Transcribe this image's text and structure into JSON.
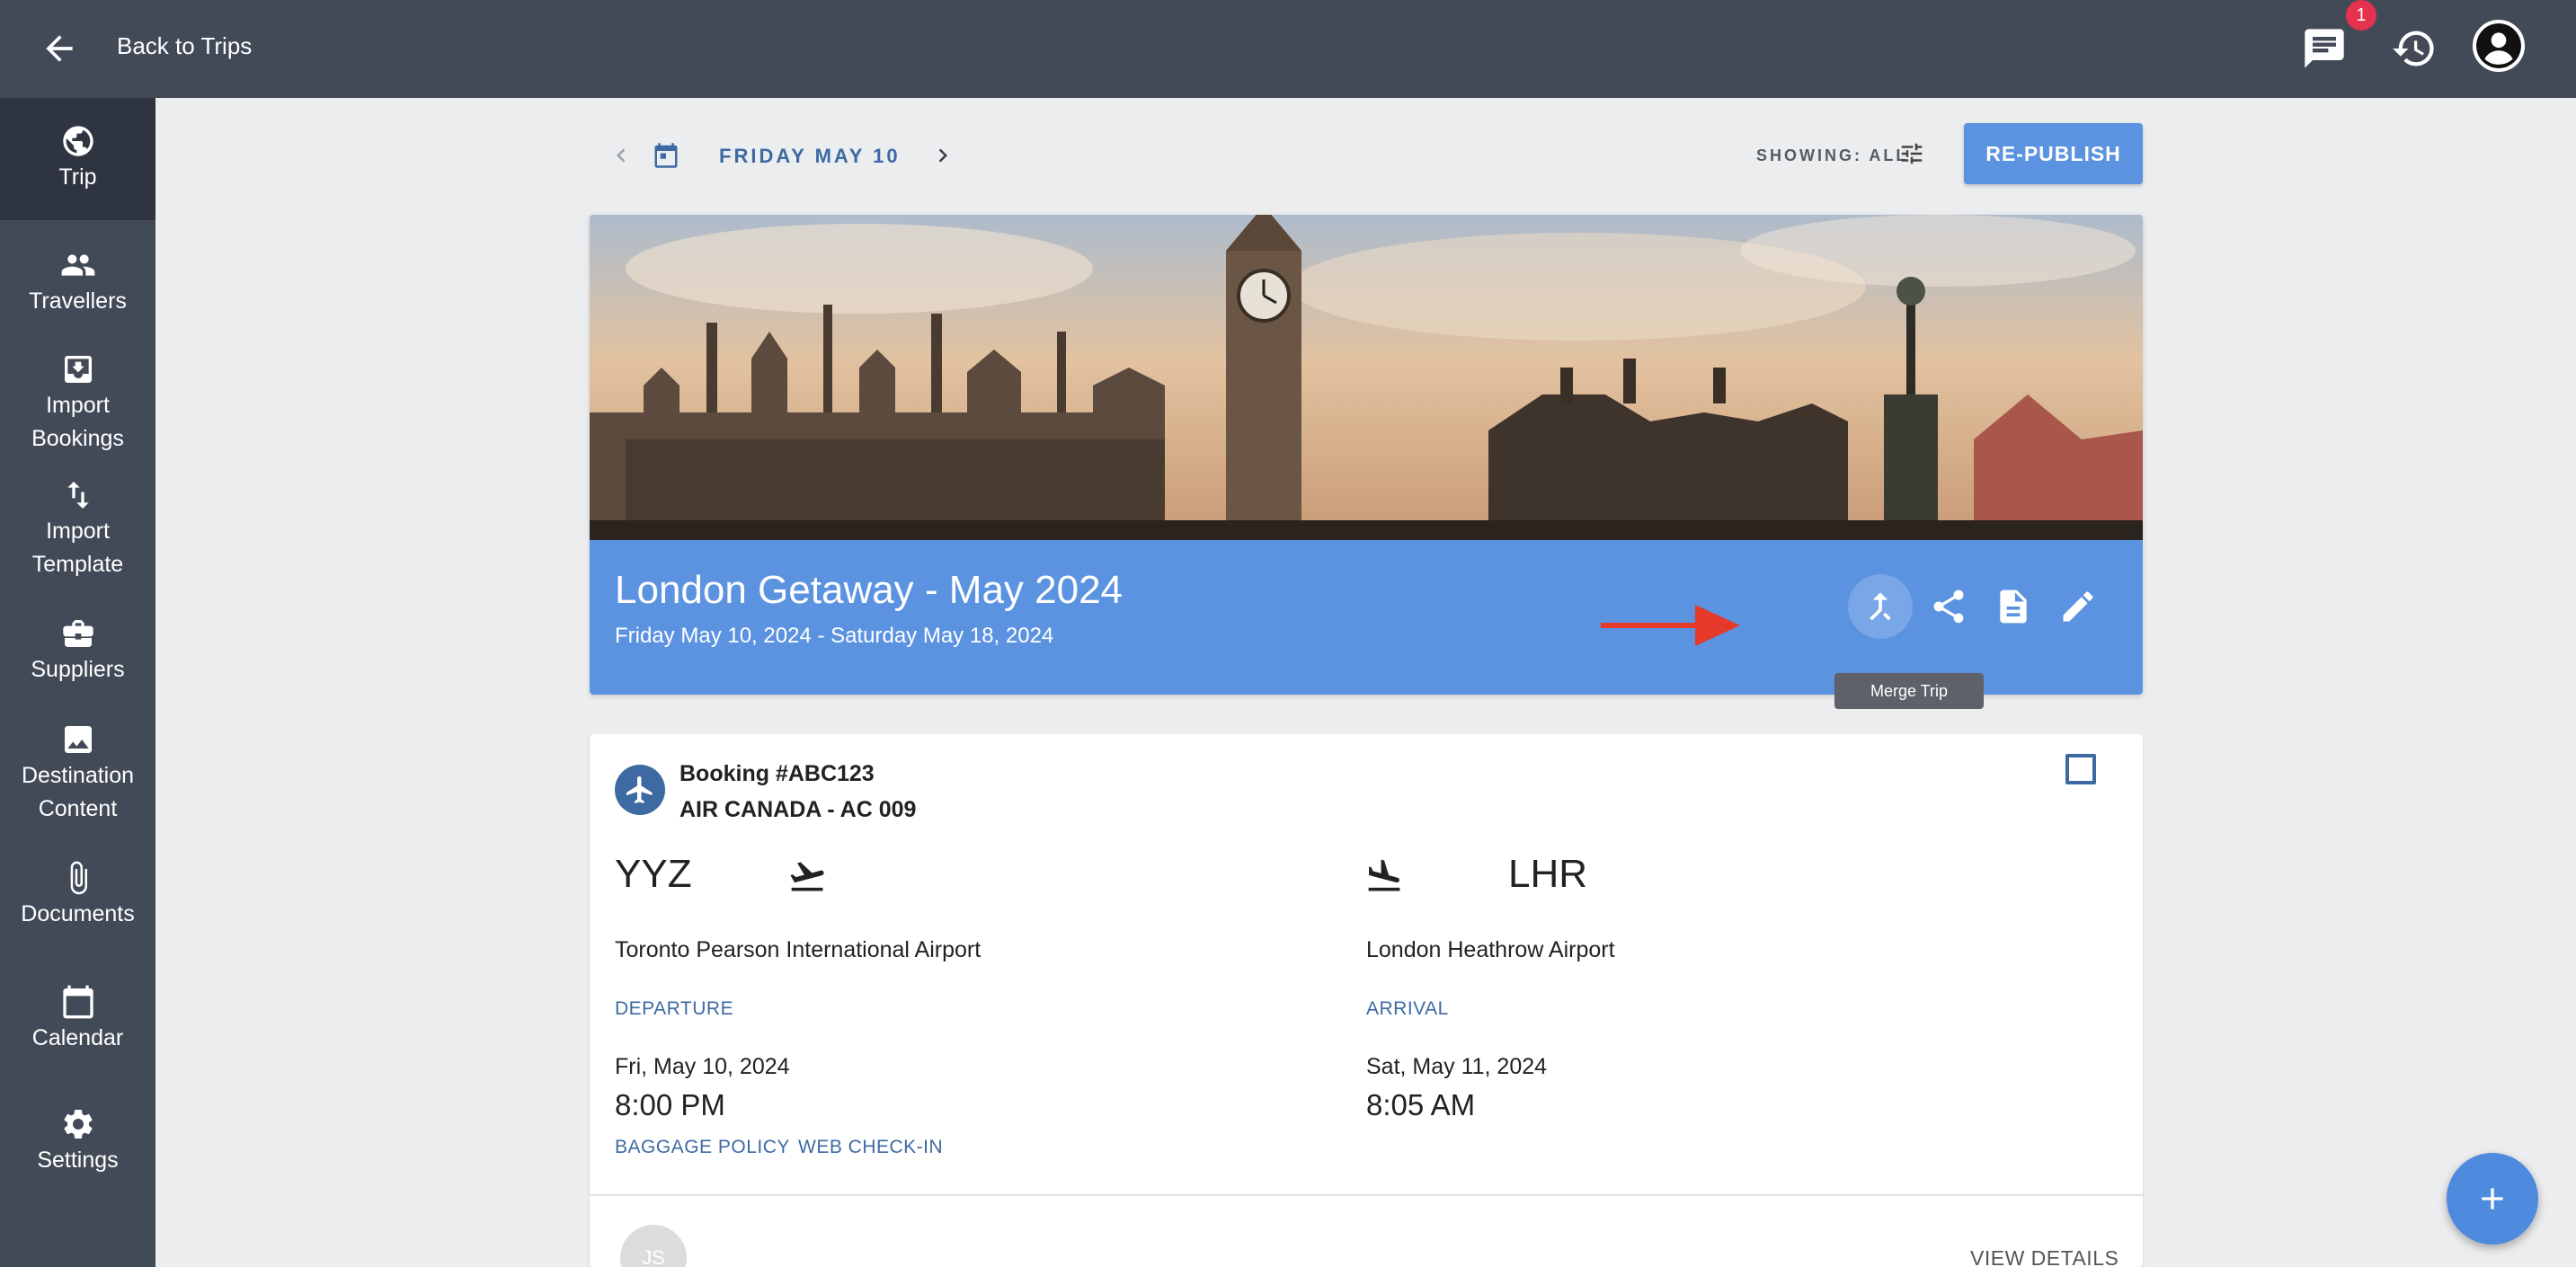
{
  "header": {
    "back_label": "Back to Trips",
    "notification_count": "1"
  },
  "sidebar": {
    "items": [
      {
        "line1": "Trip",
        "line2": "",
        "icon": "globe-icon"
      },
      {
        "line1": "Travellers",
        "line2": "",
        "icon": "people-icon"
      },
      {
        "line1": "Import",
        "line2": "Bookings",
        "icon": "import-icon"
      },
      {
        "line1": "Import",
        "line2": "Template",
        "icon": "swap-vertical-icon"
      },
      {
        "line1": "Suppliers",
        "line2": "",
        "icon": "briefcase-icon"
      },
      {
        "line1": "Destination",
        "line2": "Content",
        "icon": "image-icon"
      },
      {
        "line1": "Documents",
        "line2": "",
        "icon": "paperclip-icon"
      },
      {
        "line1": "Calendar",
        "line2": "",
        "icon": "calendar-icon"
      },
      {
        "line1": "Settings",
        "line2": "",
        "icon": "gear-icon"
      }
    ]
  },
  "toolbar": {
    "date_label": "FRIDAY MAY 10",
    "showing_label": "SHOWING: ALL",
    "republish_label": "RE-PUBLISH"
  },
  "trip": {
    "title": "London Getaway - May 2024",
    "dates": "Friday May 10, 2024 - Saturday May 18, 2024",
    "tooltip": "Merge Trip"
  },
  "booking": {
    "number": "Booking #ABC123",
    "airline": "AIR CANADA - AC 009",
    "departure": {
      "code": "YYZ",
      "airport": "Toronto Pearson International Airport",
      "label": "DEPARTURE",
      "date": "Fri, May 10, 2024",
      "time": "8:00 PM"
    },
    "arrival": {
      "code": "LHR",
      "airport": "London Heathrow Airport",
      "label": "ARRIVAL",
      "date": "Sat, May 11, 2024",
      "time": "8:05 AM"
    },
    "links": {
      "baggage": "BAGGAGE POLICY",
      "checkin": "WEB CHECK-IN"
    },
    "traveller_initials": "JS",
    "view_details": "VIEW DETAILS"
  },
  "colors": {
    "chrome": "#424a58",
    "accent": "#5b93e1",
    "link": "#3d6aa3",
    "badge": "#e4324f",
    "annotation_arrow": "#e53a2a"
  }
}
